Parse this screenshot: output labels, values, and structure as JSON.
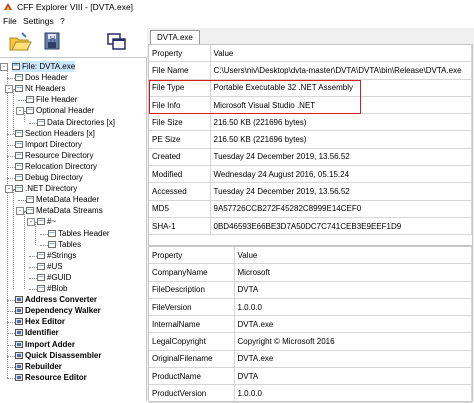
{
  "window": {
    "title": "CFF Explorer VIII - [DVTA.exe]"
  },
  "menu": [
    {
      "label": "File"
    },
    {
      "label": "Settings"
    },
    {
      "label": "?"
    }
  ],
  "tree": {
    "items": [
      {
        "label": "File: DVTA.exe",
        "icon": "file-icon"
      },
      {
        "label": "Dos Header",
        "icon": "folder-icon"
      },
      {
        "label": "Nt Headers",
        "icon": "folder-icon"
      },
      {
        "label": "File Header",
        "icon": "folder-icon"
      },
      {
        "label": "Optional Header",
        "icon": "folder-icon"
      },
      {
        "label": "Data Directories [x]",
        "icon": "folder-icon"
      },
      {
        "label": "Section Headers [x]",
        "icon": "folder-icon"
      },
      {
        "label": "Import Directory",
        "icon": "folder-icon"
      },
      {
        "label": "Resource Directory",
        "icon": "folder-icon"
      },
      {
        "label": "Relocation Directory",
        "icon": "folder-icon"
      },
      {
        "label": "Debug Directory",
        "icon": "folder-icon"
      },
      {
        "label": ".NET Directory",
        "icon": "folder-icon"
      },
      {
        "label": "MetaData Header",
        "icon": "folder-icon"
      },
      {
        "label": "MetaData Streams",
        "icon": "folder-icon"
      },
      {
        "label": "#~",
        "icon": "folder-icon"
      },
      {
        "label": "Tables Header",
        "icon": "folder-icon"
      },
      {
        "label": "Tables",
        "icon": "folder-icon"
      },
      {
        "label": "#Strings",
        "icon": "folder-icon"
      },
      {
        "label": "#US",
        "icon": "folder-icon"
      },
      {
        "label": "#GUID",
        "icon": "folder-icon"
      },
      {
        "label": "#Blob",
        "icon": "folder-icon"
      },
      {
        "label": "Address Converter",
        "icon": "tool-icon"
      },
      {
        "label": "Dependency Walker",
        "icon": "tool-icon"
      },
      {
        "label": "Hex Editor",
        "icon": "tool-icon"
      },
      {
        "label": "Identifier",
        "icon": "tool-icon"
      },
      {
        "label": "Import Adder",
        "icon": "tool-icon"
      },
      {
        "label": "Quick Disassembler",
        "icon": "tool-icon"
      },
      {
        "label": "Rebuilder",
        "icon": "tool-icon"
      },
      {
        "label": "Resource Editor",
        "icon": "tool-icon"
      }
    ]
  },
  "tab": {
    "label": "DVTA.exe"
  },
  "top_grid": {
    "headers": [
      "Property",
      "Value"
    ],
    "rows": [
      [
        "File Name",
        "C:\\Users\\niv\\Desktop\\dvta-master\\DVTA\\DVTA\\bin\\Release\\DVTA.exe"
      ],
      [
        "File Type",
        "Portable Executable 32 .NET Assembly"
      ],
      [
        "File Info",
        "Microsoft Visual Studio .NET"
      ],
      [
        "File Size",
        "216.50 KB (221696 bytes)"
      ],
      [
        "PE Size",
        "216.50 KB (221696 bytes)"
      ],
      [
        "Created",
        "Tuesday 24 December 2019, 13.56.52"
      ],
      [
        "Modified",
        "Wednesday 24 August 2016, 05.15.24"
      ],
      [
        "Accessed",
        "Tuesday 24 December 2019, 13.56.52"
      ],
      [
        "MD5",
        "9A57726CCB272F45282C8999E14CEF0"
      ],
      [
        "SHA-1",
        "0BD46593E66BE3D7A50DC7C741CEB3E9EEF1D9"
      ]
    ]
  },
  "bottom_grid": {
    "headers": [
      "Property",
      "Value"
    ],
    "rows": [
      [
        "CompanyName",
        "Microsoft"
      ],
      [
        "FileDescription",
        "DVTA"
      ],
      [
        "FileVersion",
        "1.0.0.0"
      ],
      [
        "InternalName",
        "DVTA.exe"
      ],
      [
        "LegalCopyright",
        "Copyright © Microsoft 2016"
      ],
      [
        "OriginalFilename",
        "DVTA.exe"
      ],
      [
        "ProductName",
        "DVTA"
      ],
      [
        "ProductVersion",
        "1.0.0.0"
      ]
    ]
  },
  "colors": {
    "highlight": "#d21f1f",
    "selection": "#cce8ff",
    "grid_border": "#d6d6d6"
  }
}
